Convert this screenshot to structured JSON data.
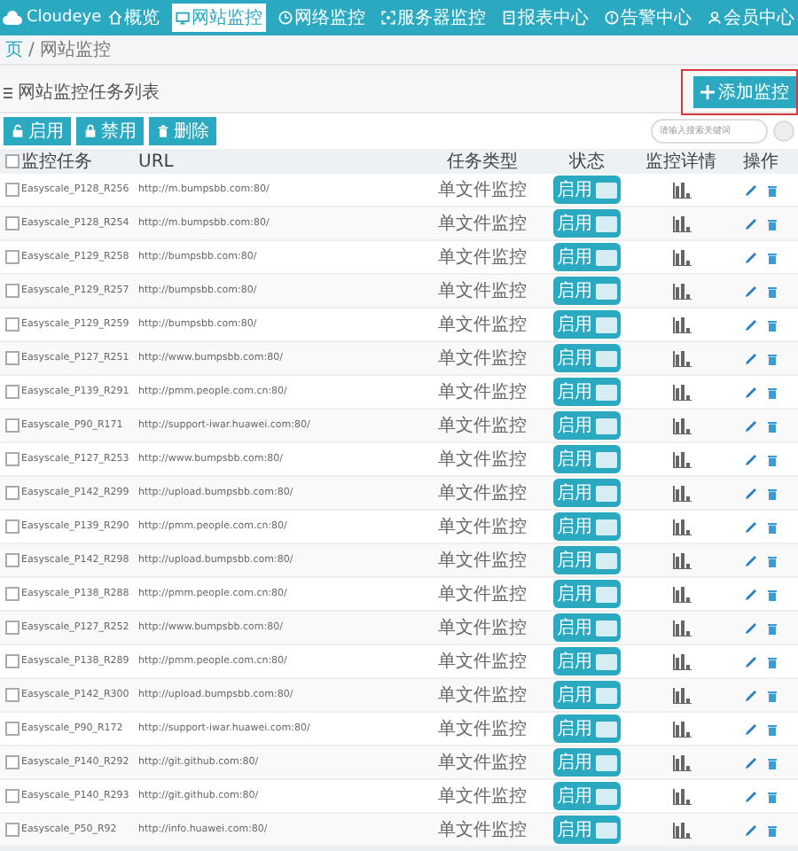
{
  "logo": "Cloudeye",
  "nav": [
    {
      "label": "概览",
      "selected": false
    },
    {
      "label": "网站监控",
      "selected": true
    },
    {
      "label": "网络监控",
      "selected": false
    },
    {
      "label": "服务器监控",
      "selected": false
    },
    {
      "label": "报表中心",
      "selected": false
    },
    {
      "label": "告警中心",
      "selected": false
    },
    {
      "label": "会员中心",
      "selected": false
    }
  ],
  "breadcrumb": {
    "items": [
      "页",
      "网站监控"
    ],
    "separator": "/"
  },
  "panel": {
    "title": "网站监控任务列表",
    "add_button": "添加监控",
    "highlighted": true
  },
  "toolbar": [
    {
      "label": "启用"
    },
    {
      "label": "禁用"
    },
    {
      "label": "删除"
    }
  ],
  "search": {
    "placeholder": "请输入搜索关键词"
  },
  "table": {
    "select_all": false,
    "columns": [
      "监控任务",
      "URL",
      "任务类型",
      "状态",
      "监控详情",
      "操作"
    ],
    "rows": [
      {
        "checked": false,
        "task": "Easyscale_P128_R256",
        "url": "http://m.bumpsbb.com:80/",
        "type": "单文件监控",
        "status": "启用",
        "on": true
      },
      {
        "checked": false,
        "task": "Easyscale_P128_R254",
        "url": "http://m.bumpsbb.com:80/",
        "type": "单文件监控",
        "status": "启用",
        "on": true
      },
      {
        "checked": false,
        "task": "Easyscale_P129_R258",
        "url": "http://bumpsbb.com:80/",
        "type": "单文件监控",
        "status": "启用",
        "on": true
      },
      {
        "checked": false,
        "task": "Easyscale_P129_R257",
        "url": "http://bumpsbb.com:80/",
        "type": "单文件监控",
        "status": "启用",
        "on": true
      },
      {
        "checked": false,
        "task": "Easyscale_P129_R259",
        "url": "http://bumpsbb.com:80/",
        "type": "单文件监控",
        "status": "启用",
        "on": true
      },
      {
        "checked": false,
        "task": "Easyscale_P127_R251",
        "url": "http://www.bumpsbb.com:80/",
        "type": "单文件监控",
        "status": "启用",
        "on": true
      },
      {
        "checked": false,
        "task": "Easyscale_P139_R291",
        "url": "http://pmm.people.com.cn:80/",
        "type": "单文件监控",
        "status": "启用",
        "on": true
      },
      {
        "checked": false,
        "task": "Easyscale_P90_R171",
        "url": "http://support-iwar.huawei.com:80/",
        "type": "单文件监控",
        "status": "启用",
        "on": true
      },
      {
        "checked": false,
        "task": "Easyscale_P127_R253",
        "url": "http://www.bumpsbb.com:80/",
        "type": "单文件监控",
        "status": "启用",
        "on": true
      },
      {
        "checked": false,
        "task": "Easyscale_P142_R299",
        "url": "http://upload.bumpsbb.com:80/",
        "type": "单文件监控",
        "status": "启用",
        "on": true
      },
      {
        "checked": false,
        "task": "Easyscale_P139_R290",
        "url": "http://pmm.people.com.cn:80/",
        "type": "单文件监控",
        "status": "启用",
        "on": true
      },
      {
        "checked": false,
        "task": "Easyscale_P142_R298",
        "url": "http://upload.bumpsbb.com:80/",
        "type": "单文件监控",
        "status": "启用",
        "on": true
      },
      {
        "checked": false,
        "task": "Easyscale_P138_R288",
        "url": "http://pmm.people.com.cn:80/",
        "type": "单文件监控",
        "status": "启用",
        "on": true
      },
      {
        "checked": false,
        "task": "Easyscale_P127_R252",
        "url": "http://www.bumpsbb.com:80/",
        "type": "单文件监控",
        "status": "启用",
        "on": true
      },
      {
        "checked": false,
        "task": "Easyscale_P138_R289",
        "url": "http://pmm.people.com.cn:80/",
        "type": "单文件监控",
        "status": "启用",
        "on": true
      },
      {
        "checked": false,
        "task": "Easyscale_P142_R300",
        "url": "http://upload.bumpsbb.com:80/",
        "type": "单文件监控",
        "status": "启用",
        "on": true
      },
      {
        "checked": false,
        "task": "Easyscale_P90_R172",
        "url": "http://support-iwar.huawei.com:80/",
        "type": "单文件监控",
        "status": "启用",
        "on": true
      },
      {
        "checked": false,
        "task": "Easyscale_P140_R292",
        "url": "http://git.github.com:80/",
        "type": "单文件监控",
        "status": "启用",
        "on": true
      },
      {
        "checked": false,
        "task": "Easyscale_P140_R293",
        "url": "http://git.github.com:80/",
        "type": "单文件监控",
        "status": "启用",
        "on": true
      },
      {
        "checked": false,
        "task": "Easyscale_P50_R92",
        "url": "http://info.huawei.com:80/",
        "type": "单文件监控",
        "status": "启用",
        "on": true
      }
    ]
  }
}
